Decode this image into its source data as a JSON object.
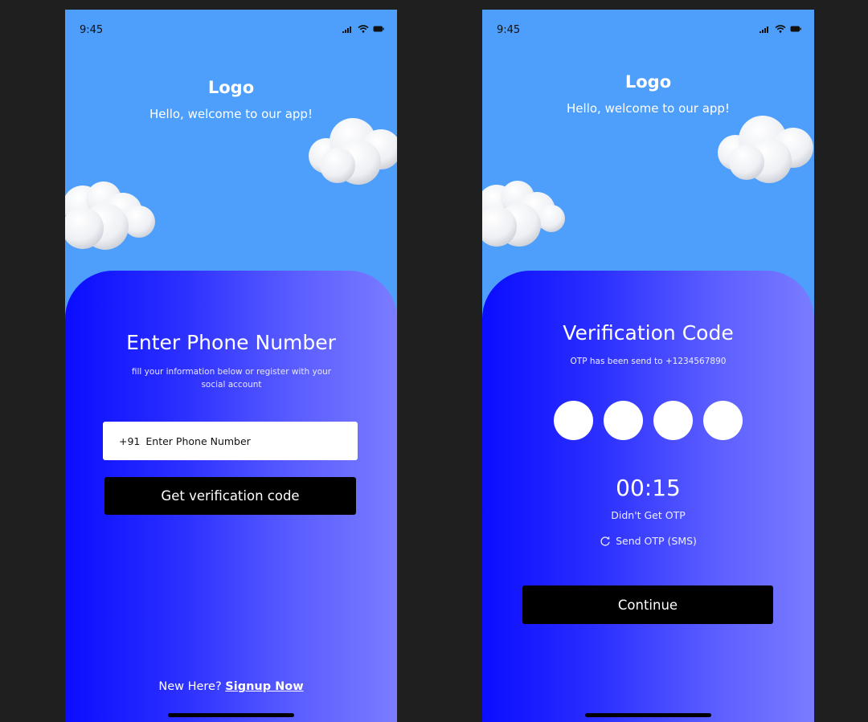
{
  "screen1": {
    "status_time": "9:45",
    "logo": "Logo",
    "welcome": "Hello, welcome to our app!",
    "title": "Enter Phone Number",
    "subtitle": "fill your information below or register with your social account",
    "country_code": "+91",
    "phone_placeholder": "Enter Phone Number",
    "button_label": "Get verification code",
    "footer_prefix": "New Here?",
    "footer_link": "Signup Now"
  },
  "screen2": {
    "status_time": "9:45",
    "logo": "Logo",
    "welcome": "Hello, welcome to our app!",
    "title": "Verification Code",
    "subtitle": "OTP has been send to +1234567890",
    "timer": "00:15",
    "didnt_get": "Didn't Get OTP",
    "resend": "Send OTP (SMS)",
    "button_label": "Continue"
  },
  "colors": {
    "sky": "#4d9ffb",
    "panel_start": "#0a0dff",
    "panel_end": "#7a7cff",
    "button": "#000000",
    "page_bg": "#1f1f1f"
  },
  "icons": [
    "signal-icon",
    "wifi-icon",
    "battery-icon",
    "cloud-icon",
    "refresh-icon"
  ]
}
